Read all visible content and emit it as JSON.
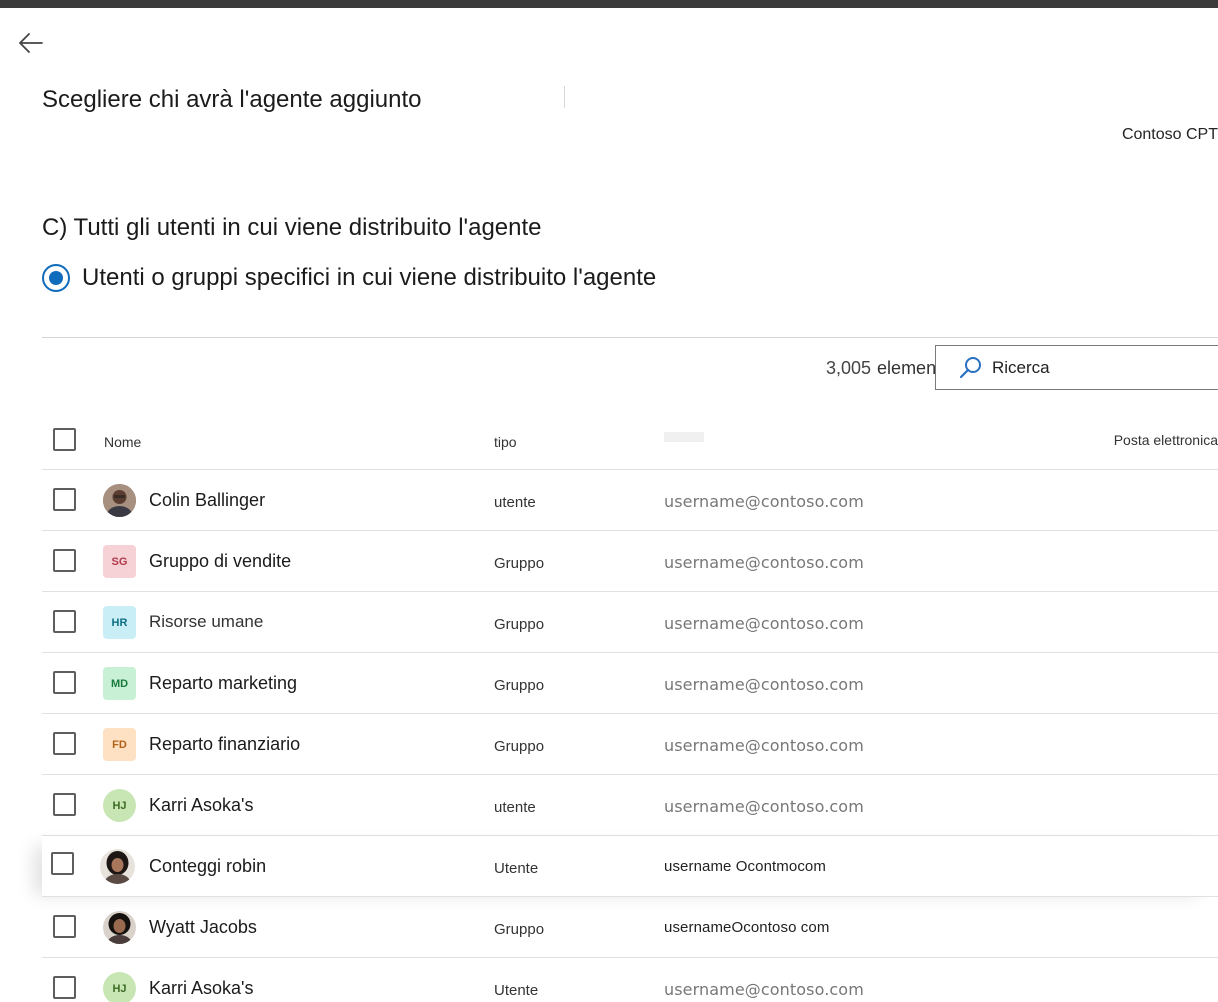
{
  "header": {
    "title": "Scegliere chi avrà l'agente aggiunto",
    "tenant": "Contoso CPT"
  },
  "options": {
    "all_users": "C) Tutti gli utenti in cui viene distribuito l'agente",
    "specific": "Utenti o gruppi specifici in cui viene distribuito l'agente",
    "selected": "specific"
  },
  "toolbar": {
    "count": "3,005",
    "count_label": "elementi",
    "search_placeholder": "Ricerca"
  },
  "table": {
    "columns": {
      "name": "Nome",
      "type": "tipo",
      "email": "Posta elettronica"
    },
    "rows": [
      {
        "name": "Colin Ballinger",
        "type": "utente",
        "email": "username@contoso.com",
        "initials": "",
        "avatar_kind": "photo-1"
      },
      {
        "name": "Gruppo di vendite",
        "type": "Gruppo",
        "email": "username@contoso.com",
        "initials": "SG",
        "avatar_kind": "pink"
      },
      {
        "name": "Risorse umane",
        "type": "Gruppo",
        "email": "username@contoso.com",
        "initials": "HR",
        "avatar_kind": "cyan"
      },
      {
        "name": "Reparto marketing",
        "type": "Gruppo",
        "email": "username@contoso.com",
        "initials": "MD",
        "avatar_kind": "green"
      },
      {
        "name": "Reparto finanziario",
        "type": "Gruppo",
        "email": "username@contoso.com",
        "initials": "FD",
        "avatar_kind": "peach"
      },
      {
        "name": "Karri Asoka's",
        "type": "utente",
        "email": "username@contoso.com",
        "initials": "HJ",
        "avatar_kind": "olive"
      },
      {
        "name": "Conteggi robin",
        "type": "Utente",
        "email": "username Ocontmocom",
        "initials": "",
        "avatar_kind": "photo-2"
      },
      {
        "name": "Wyatt Jacobs",
        "type": "Gruppo",
        "email": "usernameOcontoso com",
        "initials": "",
        "avatar_kind": "photo-3"
      },
      {
        "name": "Karri Asoka's",
        "type": "Utente",
        "email": "username@contoso.com",
        "initials": "HJ",
        "avatar_kind": "olive"
      }
    ]
  },
  "colors": {
    "accent": "#0f6cbd",
    "pink": "#f6d1d5",
    "cyan": "#c9eef5",
    "green": "#c8f0d4",
    "peach": "#fde1c2",
    "olive": "#c7e6b4"
  }
}
